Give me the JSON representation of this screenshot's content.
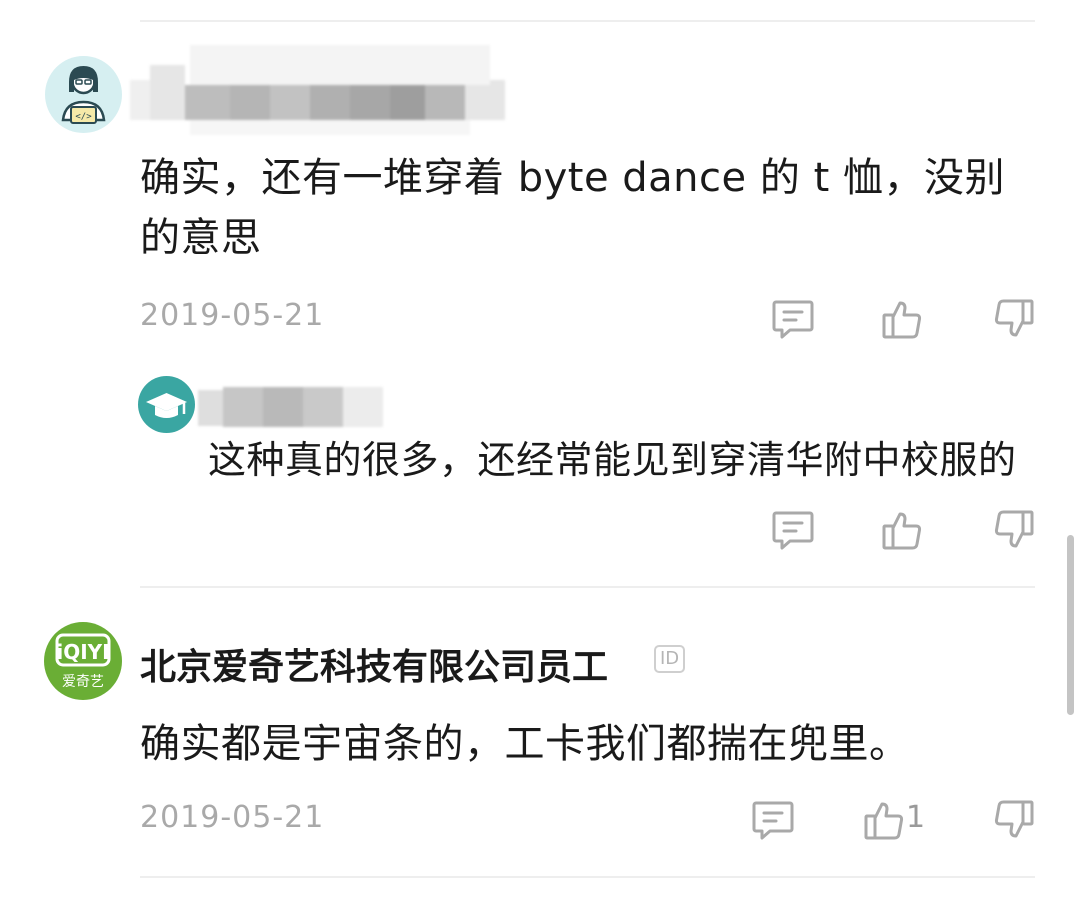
{
  "comments": [
    {
      "username": "",
      "text_line1": "确实，还有一堆穿着 byte dance 的 t 恤，没别",
      "text_line2": "的意思",
      "date": "2019-05-21"
    }
  ],
  "reply": {
    "username": "",
    "text": "这种真的很多，还经常能见到穿清华附中校服的"
  },
  "second_comment": {
    "username": "北京爱奇艺科技有限公司员工",
    "id_badge": "ID",
    "avatar_logo_text": "iQIYI",
    "avatar_sub_text": "爱奇艺",
    "text": "确实都是宇宙条的，工卡我们都揣在兜里。",
    "date": "2019-05-21",
    "like_count": "1"
  },
  "colors": {
    "iqiyi_green": "#6aae35",
    "teal": "#3aa6a2",
    "avatar_bg_light": "#d8f0f2"
  },
  "icons": [
    "comment-icon",
    "thumbs-up-icon",
    "thumbs-down-icon",
    "graduation-cap-icon",
    "coder-avatar-icon"
  ]
}
